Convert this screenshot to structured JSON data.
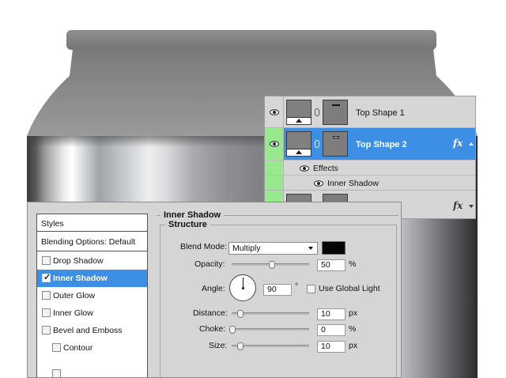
{
  "layers_panel": {
    "layers": [
      {
        "name": "Top Shape 1",
        "selected": false,
        "has_fx": false
      },
      {
        "name": "Top Shape 2",
        "selected": true,
        "has_fx": true,
        "fx_label": "fx"
      },
      {
        "name": "",
        "selected": false,
        "has_fx": true,
        "fx_label": "fx"
      }
    ],
    "effects_label": "Effects",
    "effect_items": [
      "Inner Shadow"
    ],
    "colors": {
      "selected_row": "#3d8fe6",
      "visibility_highlight": "#97e88f"
    }
  },
  "layer_style_dialog": {
    "style_list": {
      "header": "Styles",
      "blending_options": "Blending Options: Default",
      "items": [
        {
          "label": "Drop Shadow",
          "checked": false,
          "selected": false,
          "indent": false
        },
        {
          "label": "Inner Shadow",
          "checked": true,
          "selected": true,
          "indent": false
        },
        {
          "label": "Outer Glow",
          "checked": false,
          "selected": false,
          "indent": false
        },
        {
          "label": "Inner Glow",
          "checked": false,
          "selected": false,
          "indent": false
        },
        {
          "label": "Bevel and Emboss",
          "checked": false,
          "selected": false,
          "indent": false
        },
        {
          "label": "Contour",
          "checked": false,
          "selected": false,
          "indent": true
        }
      ]
    },
    "panel_title": "Inner Shadow",
    "group_title": "Structure",
    "blend_mode": {
      "label": "Blend Mode:",
      "value": "Multiply",
      "color": "#050505"
    },
    "opacity": {
      "label": "Opacity:",
      "value": "50",
      "unit": "%",
      "level": 0.5
    },
    "angle": {
      "label": "Angle:",
      "value": "90",
      "unit": "°",
      "use_global_light_label": "Use Global Light",
      "use_global_light": false
    },
    "distance": {
      "label": "Distance:",
      "value": "10",
      "unit": "px",
      "level": 0.1
    },
    "choke": {
      "label": "Choke:",
      "value": "0",
      "unit": "%",
      "level": 0.0
    },
    "size": {
      "label": "Size:",
      "value": "10",
      "unit": "px",
      "level": 0.1
    }
  }
}
